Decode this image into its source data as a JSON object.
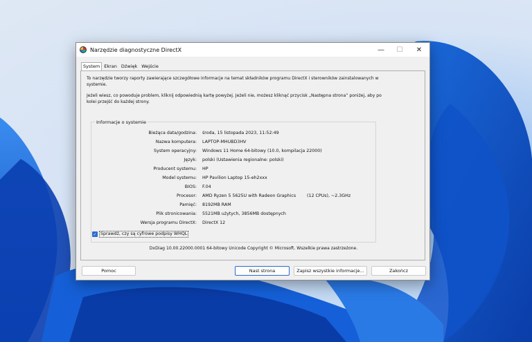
{
  "window": {
    "title": "Narzędzie diagnostyczne DirectX",
    "minimize": "—",
    "maximize": "☐",
    "close": "✕"
  },
  "tabs": [
    {
      "label": "System",
      "active": true
    },
    {
      "label": "Ekran",
      "active": false
    },
    {
      "label": "Dźwięk",
      "active": false
    },
    {
      "label": "Wejście",
      "active": false
    }
  ],
  "intro": {
    "line1": "To narzędzie tworzy raporty zawierające szczegółowe informacje na temat składników programu DirectX i sterowników zainstalowanych w systemie.",
    "line2": "Jeżeli wiesz, co powoduje problem, kliknij odpowiednią kartę powyżej. Jeżeli nie, możesz kliknąć przycisk „Następna strona” poniżej, aby po kolei przejść do każdej strony."
  },
  "system_info": {
    "group_label": "Informacje o systemie",
    "rows": [
      {
        "label": "Bieżąca data/godzina:",
        "value": "środa, 15 listopada 2023, 11:52:49"
      },
      {
        "label": "Nazwa komputera:",
        "value": "LAPTOP-MHUBD3HV"
      },
      {
        "label": "System operacyjny:",
        "value": "Windows 11 Home 64-bitowy (10.0, kompilacja 22000)"
      },
      {
        "label": "Język:",
        "value": "polski (Ustawienia regionalne: polski)"
      },
      {
        "label": "Producent systemu:",
        "value": "HP"
      },
      {
        "label": "Model systemu:",
        "value": "HP Pavilion Laptop 15-eh2xxx"
      },
      {
        "label": "BIOS:",
        "value": "F.04"
      },
      {
        "label": "Procesor:",
        "value": "AMD Ryzen 5 5625U with Radeon Graphics",
        "value2": "(12 CPUs), ~2.3GHz"
      },
      {
        "label": "Pamięć:",
        "value": "8192MB RAM"
      },
      {
        "label": "Plik stronicowania:",
        "value": "5521MB użytych, 3856MB dostępnych"
      },
      {
        "label": "Wersja programu DirectX:",
        "value": "DirectX 12"
      }
    ]
  },
  "whql": {
    "label": "Sprawdź, czy są cyfrowe podpisy WHQL",
    "checked": true,
    "mark": "✓"
  },
  "footer_note": "DxDiag 10.00.22000.0001 64-bitowy Unicode  Copyright © Microsoft. Wszelkie prawa zastrzeżone.",
  "buttons": {
    "help": "Pomoc",
    "next": "Nast strona",
    "save": "Zapisz wszystkie informacje...",
    "exit": "Zakończ"
  }
}
